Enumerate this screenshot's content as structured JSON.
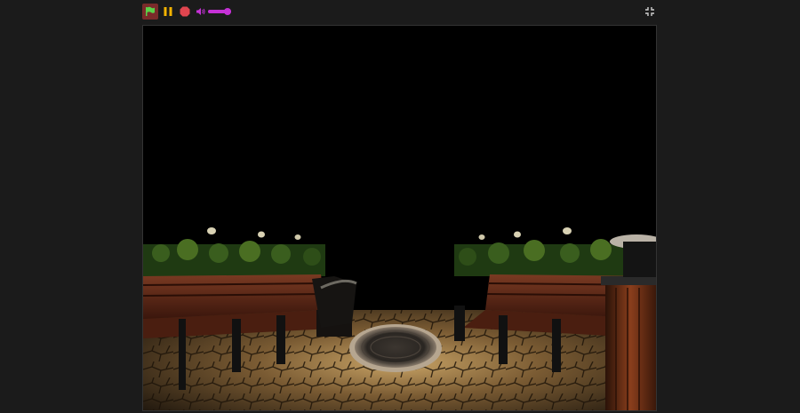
{
  "toolbar": {
    "icons": [
      "green-flag-icon",
      "pause-icon",
      "stop-icon",
      "volume-icon",
      "fullscreen-exit-icon"
    ],
    "volume_level": 0.85
  },
  "colors": {
    "background": "#1b1b1b",
    "flag_bg": "#7a2a2a",
    "flag": "#5ad14a",
    "pause": "#f3b300",
    "stop": "#e0454f",
    "volume_accent": "#c531d6",
    "stage_bg": "#000000"
  },
  "scene": {
    "description_icons": [
      "park-bench-left",
      "park-bench-right",
      "manhole-cover",
      "street-lamp",
      "trash-bin",
      "hedge"
    ]
  }
}
